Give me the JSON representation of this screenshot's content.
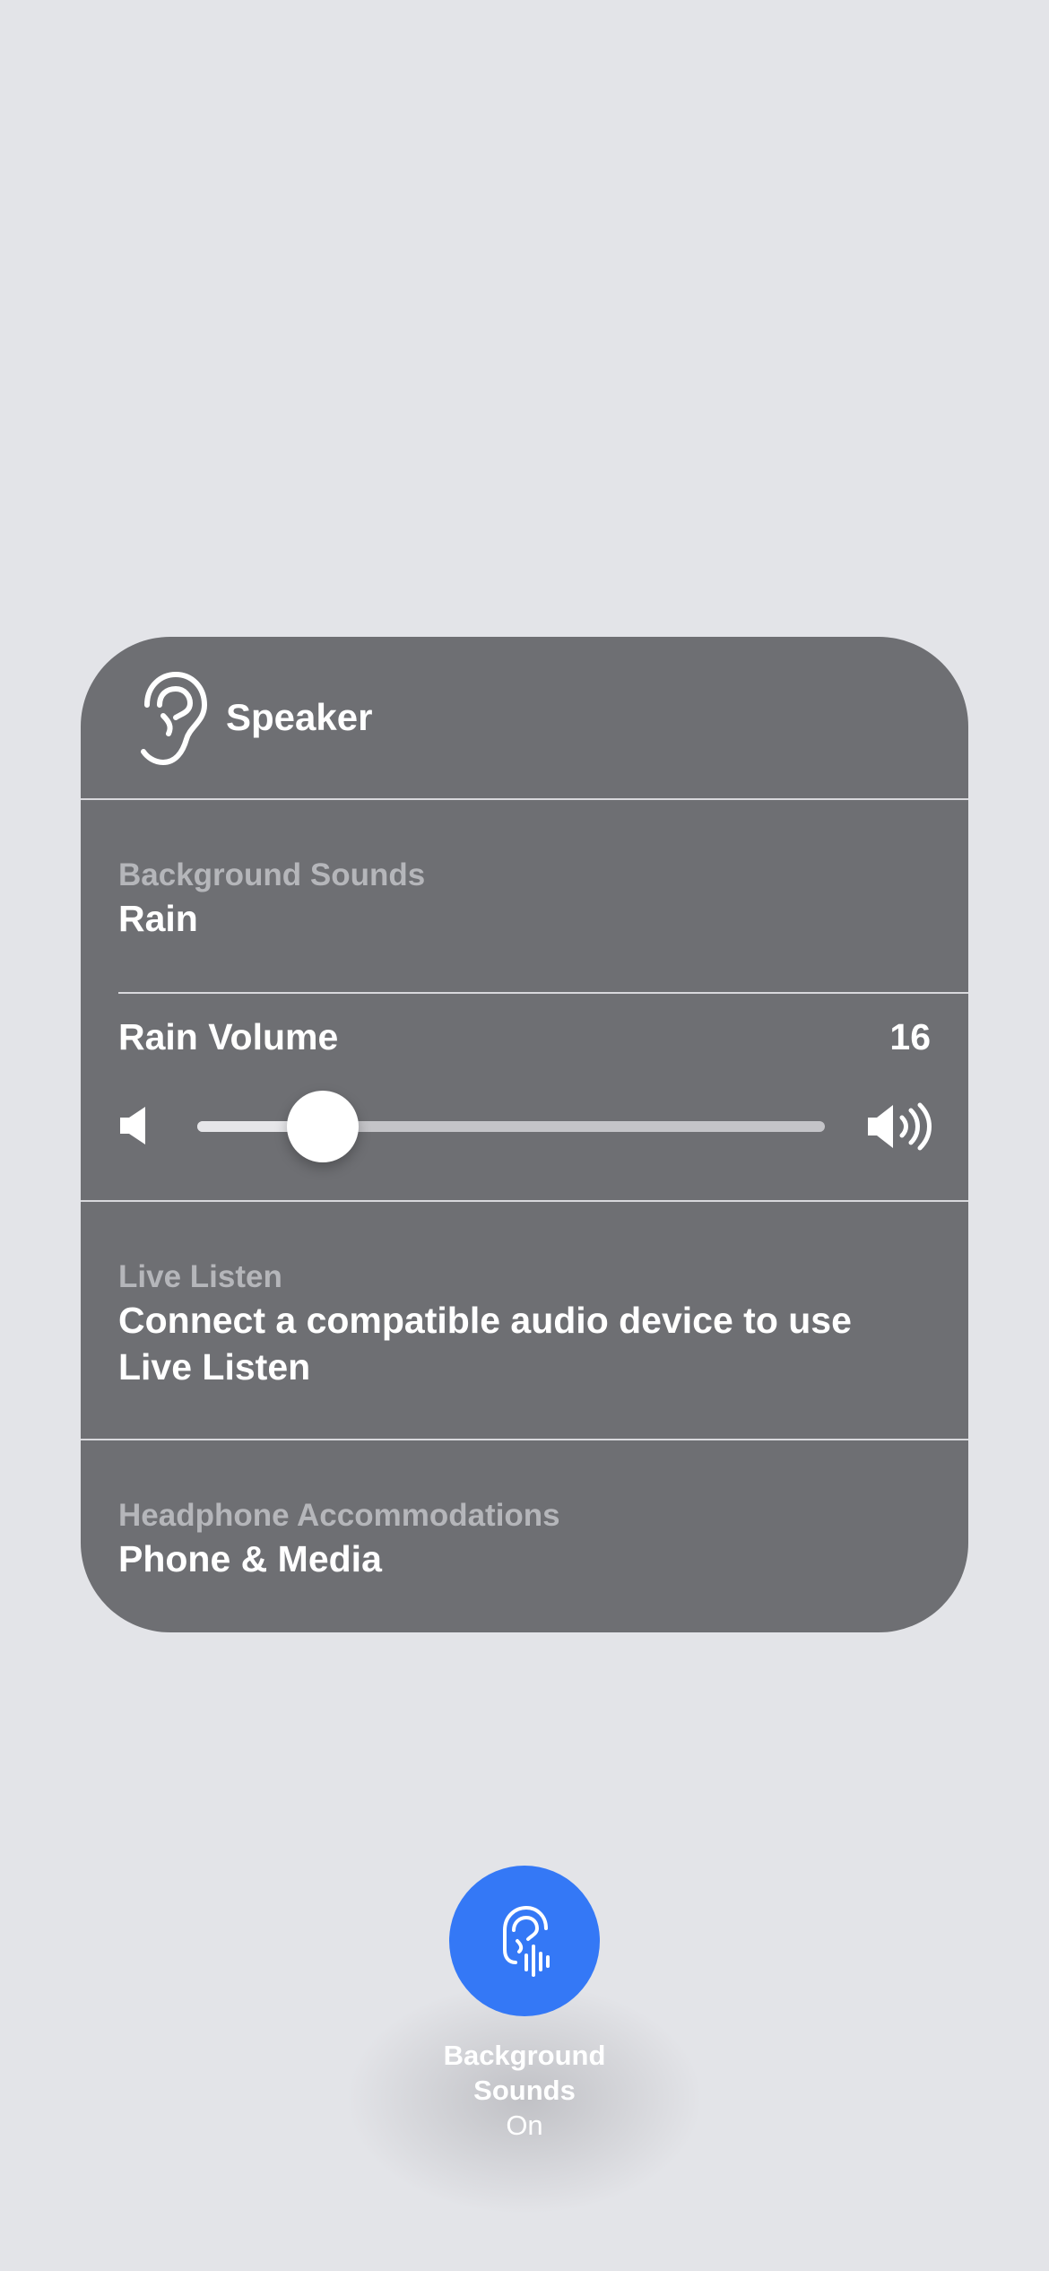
{
  "panel": {
    "title": "Speaker",
    "header_icon": "ear-icon",
    "background_sounds": {
      "label": "Background Sounds",
      "value": "Rain"
    },
    "volume": {
      "label": "Rain Volume",
      "value": "16",
      "level_fraction": 0.2,
      "low_icon": "speaker-low-icon",
      "high_icon": "speaker-high-icon"
    },
    "live_listen": {
      "label": "Live Listen",
      "line1": "Connect a compatible audio device to use",
      "line2": "Live Listen"
    },
    "headphone_accommodations": {
      "label": "Headphone Accommodations",
      "value": "Phone & Media"
    }
  },
  "toggle": {
    "icon": "ear-sound-icon",
    "line1": "Background",
    "line2": "Sounds",
    "state": "On",
    "color": "#3478f6"
  },
  "colors": {
    "background": "#e3e4e8",
    "panel": "#6e6f73",
    "muted_text": "#b5b6ba"
  }
}
